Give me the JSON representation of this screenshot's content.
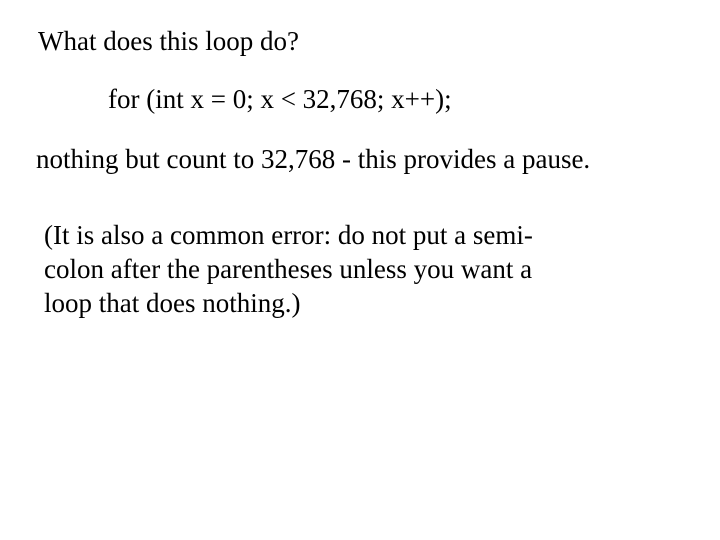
{
  "slide": {
    "question": "What does this loop do?",
    "code": "for (int x = 0; x < 32,768; x++);",
    "answer": "nothing but count to 32,768 -  this provides a pause.",
    "note_lines": [
      "(It is also a common error:  do not put a semi-",
      "colon after the parentheses unless you want a",
      "loop that does nothing.)"
    ]
  }
}
